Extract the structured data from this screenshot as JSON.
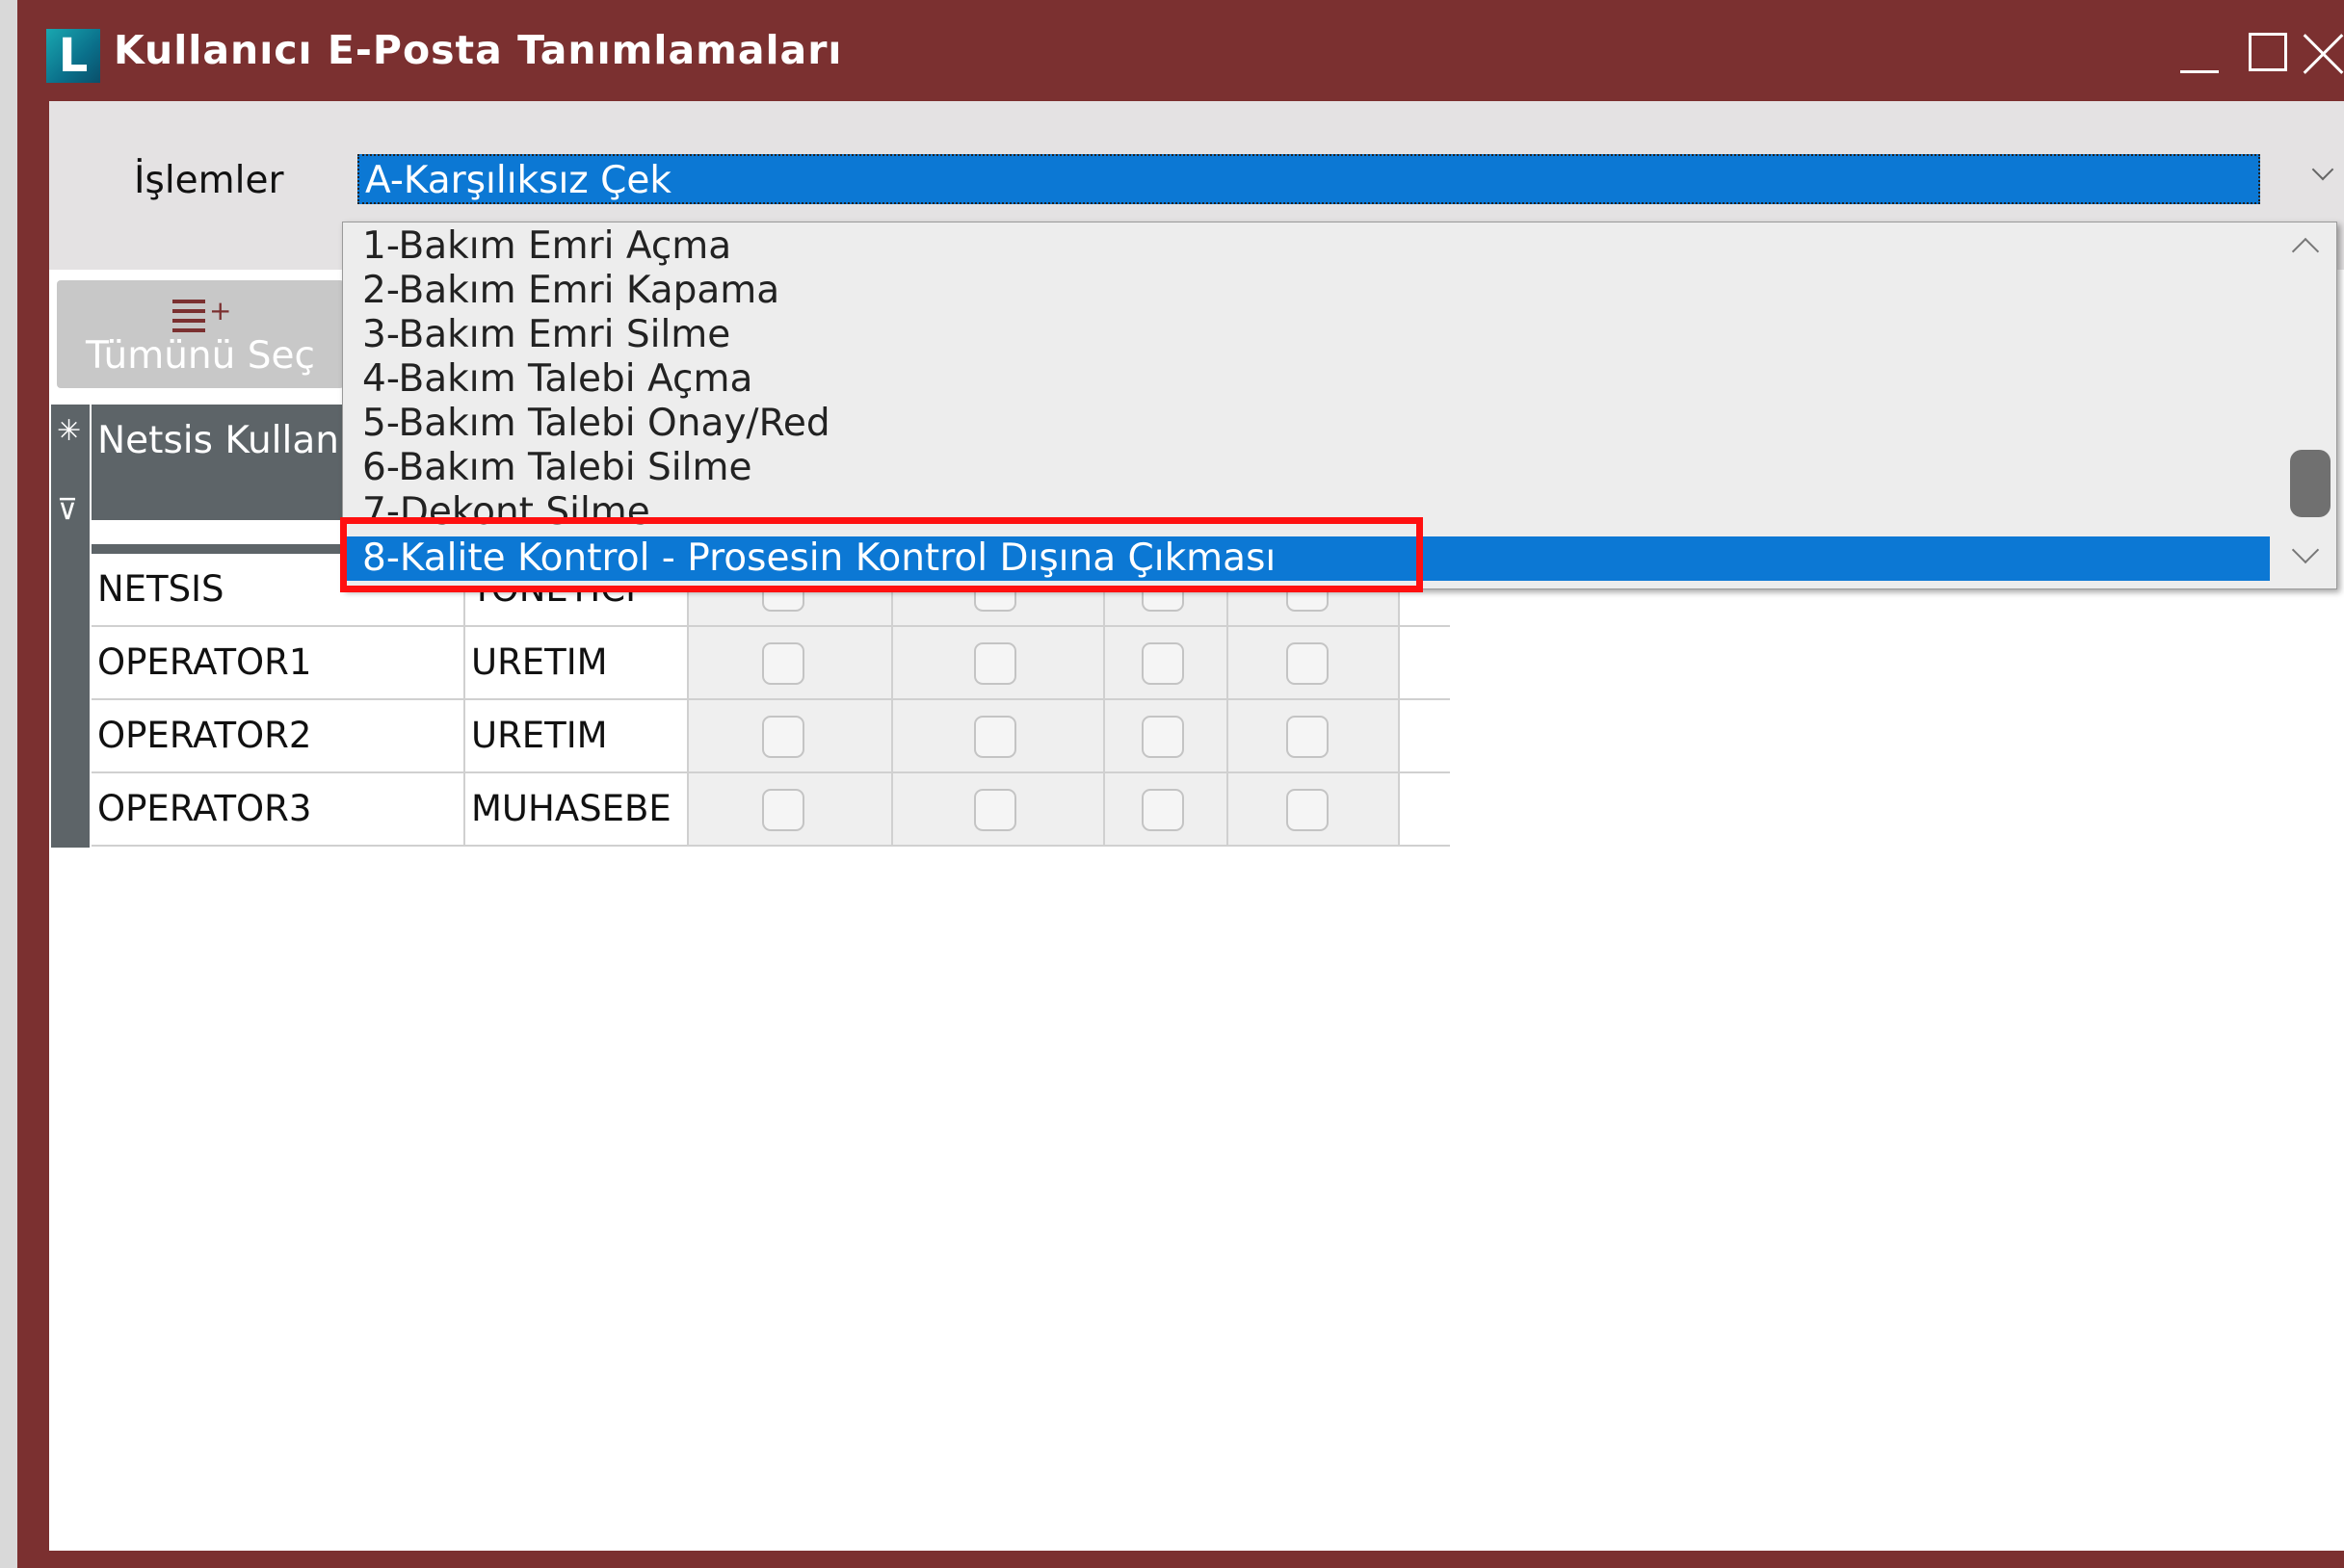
{
  "window": {
    "title": "Kullanıcı E-Posta Tanımlamaları",
    "logo_letter": "L"
  },
  "toolbar": {
    "operations_label": "İşlemler",
    "selected_operation": "A-Karşılıksız Çek",
    "select_all_label": "Tümünü Seç"
  },
  "grid": {
    "header_user": "Netsis Kullan",
    "rows": [
      {
        "user": "NETSIS",
        "group": "YONETICI"
      },
      {
        "user": "OPERATOR1",
        "group": "URETIM"
      },
      {
        "user": "OPERATOR2",
        "group": "URETIM"
      },
      {
        "user": "OPERATOR3",
        "group": "MUHASEBE"
      }
    ]
  },
  "dropdown": {
    "items": [
      "1-Bakım Emri Açma",
      "2-Bakım Emri Kapama",
      "3-Bakım Emri Silme",
      "4-Bakım Talebi Açma",
      "5-Bakım Talebi Onay/Red",
      "6-Bakım Talebi Silme",
      "7-Dekont Silme",
      "8-Kalite Kontrol - Prosesin Kontrol Dışına Çıkması"
    ],
    "selected_index": 7
  },
  "colors": {
    "title_bar": "#7b3030",
    "selection": "#0c78d4",
    "highlight": "#ff1010",
    "grid_header": "#5d6468"
  },
  "icons": {
    "select_all": "list-add-icon",
    "grid_corner": "asterisk-icon",
    "grid_filter": "filter-icon"
  }
}
